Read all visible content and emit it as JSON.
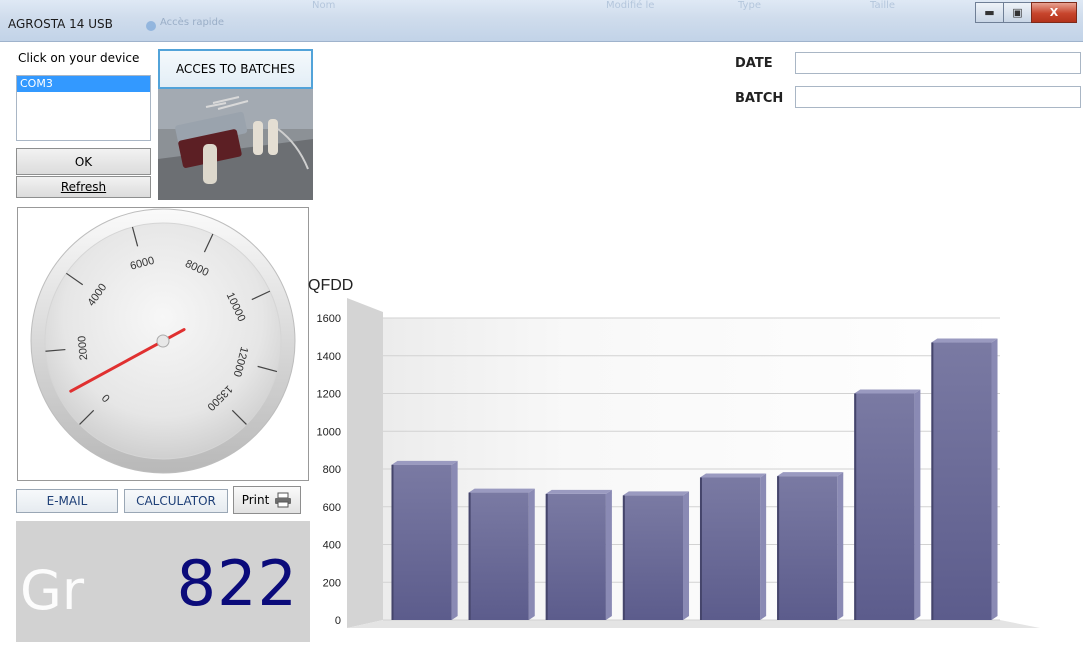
{
  "window": {
    "title": "AGROSTA 14 USB",
    "quick_access": "Accès rapide",
    "ghost_headers": [
      "Nom",
      "Modifié le",
      "Type",
      "Taille"
    ],
    "controls": {
      "minimize_icon": "minimize-icon",
      "maximize_icon": "maximize-icon",
      "close_label": "X"
    }
  },
  "device": {
    "prompt": "Click on your device",
    "ports": [
      "COM3"
    ],
    "selected": "COM3",
    "ok_label": "OK",
    "refresh_label": "Refresh"
  },
  "batches": {
    "button_label": "ACCES TO BATCHES",
    "date_label": "DATE",
    "date_value": "",
    "batch_label": "BATCH",
    "batch_value": ""
  },
  "gauge": {
    "ticks": [
      "0",
      "2000",
      "4000",
      "6000",
      "8000",
      "10000",
      "12000",
      "13500"
    ],
    "min": 0,
    "max": 13500,
    "needle_value": 822,
    "needle_color": "#e03030"
  },
  "actions": {
    "email_label": "E-MAIL",
    "calculator_label": "CALCULATOR",
    "print_label": "Print"
  },
  "readout": {
    "unit": "Gr",
    "value": "822"
  },
  "chart_data": {
    "type": "bar",
    "title": "QFDD",
    "ylim": [
      0,
      1600
    ],
    "yticks": [
      0,
      200,
      400,
      600,
      800,
      1000,
      1200,
      1400,
      1600
    ],
    "values": [
      822,
      675,
      668,
      660,
      755,
      762,
      1200,
      1470
    ],
    "bar_color": "#6e6e98",
    "three_d": true,
    "grid": true
  }
}
